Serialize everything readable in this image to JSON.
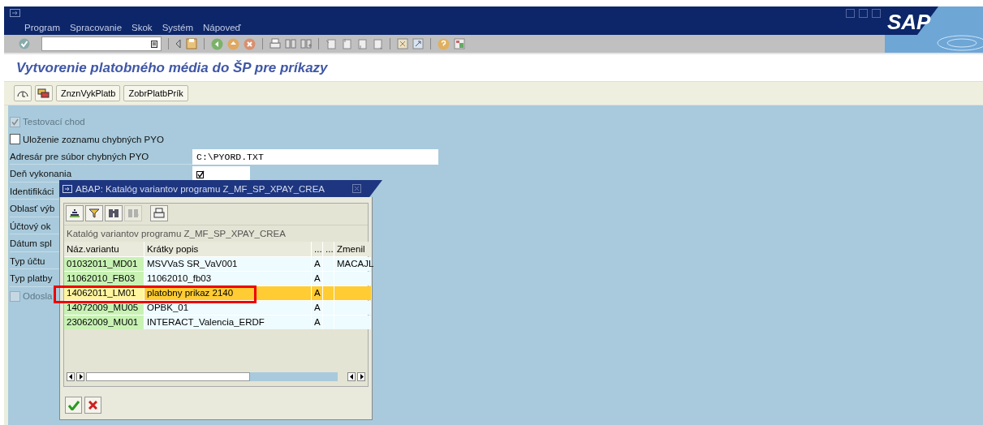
{
  "logo": "SAP",
  "menu": [
    "Program",
    "Spracovanie",
    "Skok",
    "Systém",
    "Nápoveď"
  ],
  "title": "Vytvorenie platobného média do ŠP pre príkazy",
  "app_buttons": [
    "ZnznVykPlatb",
    "ZobrPlatbPrík"
  ],
  "form": [
    {
      "kind": "checkbox",
      "label": "Testovací chod",
      "checked": true,
      "disabled": true
    },
    {
      "kind": "checkbox",
      "label": "Uloženie zoznamu chybných PYO",
      "checked": false,
      "disabled": false
    },
    {
      "kind": "field",
      "label": "Adresár pre súbor chybných PYO",
      "value": "C:\\PYORD.TXT"
    },
    {
      "kind": "checkfield",
      "label": "Deň vykonania",
      "checked": true
    },
    {
      "kind": "label",
      "label": "Identifikáci"
    },
    {
      "kind": "label",
      "label": "Oblasť výb"
    },
    {
      "kind": "label",
      "label": "Účtový ok"
    },
    {
      "kind": "label",
      "label": "Dátum spl"
    },
    {
      "kind": "label",
      "label": "Typ účtu"
    },
    {
      "kind": "label",
      "label": "Typ platby"
    },
    {
      "kind": "checkbox",
      "label": "Odosla",
      "checked": false,
      "disabled": true
    }
  ],
  "dialog": {
    "title": "ABAP: Katalóg variantov programu Z_MF_SP_XPAY_CREA",
    "tools": [
      {
        "disabled": false
      },
      {
        "disabled": false
      },
      {
        "disabled": false
      },
      {
        "disabled": true
      },
      {
        "disabled": false
      }
    ],
    "caption": "Katalóg variantov programu Z_MF_SP_XPAY_CREA",
    "columns": [
      "Náz.variantu",
      "Krátky popis",
      "...",
      "...",
      "Zmenil"
    ],
    "rows": [
      {
        "cells": [
          "01032011_MD01",
          "MSVVaS SR_VaV001",
          "A",
          "",
          "MACAJL"
        ],
        "selected": false
      },
      {
        "cells": [
          "11062010_FB03",
          "11062010_fb03",
          "A",
          "",
          ""
        ],
        "selected": false
      },
      {
        "cells": [
          "14062011_LM01",
          "platobny prikaz 2140",
          "A",
          "",
          ""
        ],
        "selected": true
      },
      {
        "cells": [
          "14072009_MU05",
          "OPBK_01",
          "A",
          "",
          ""
        ],
        "selected": false
      },
      {
        "cells": [
          "23062009_MU01",
          "INTERACT_Valencia_ERDF",
          "A",
          "",
          ""
        ],
        "selected": false
      }
    ]
  }
}
